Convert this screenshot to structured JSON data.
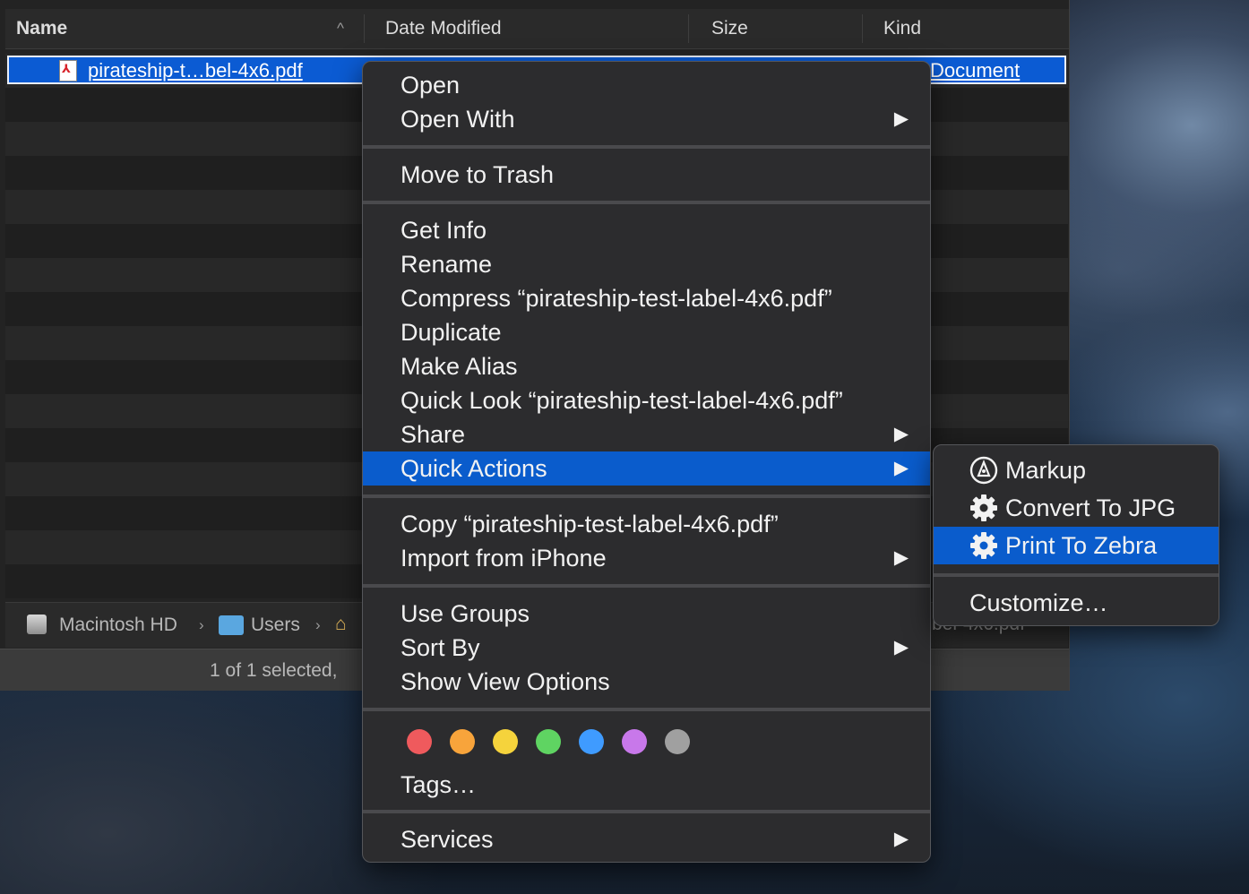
{
  "finder": {
    "columns": {
      "name": "Name",
      "date_modified": "Date Modified",
      "size": "Size",
      "kind": "Kind"
    },
    "sort_indicator": "^",
    "selected_file": {
      "name": "pirateship-t…bel-4x6.pdf",
      "kind_visible": "Document"
    },
    "pathbar": {
      "items": [
        "Macintosh HD",
        "Users"
      ],
      "separator": "›",
      "right_fragment": "bel-4x6.pdf"
    },
    "status": "1 of 1 selected,"
  },
  "context_menu": {
    "groups": [
      [
        {
          "label": "Open"
        },
        {
          "label": "Open With",
          "submenu": true
        }
      ],
      [
        {
          "label": "Move to Trash"
        }
      ],
      [
        {
          "label": "Get Info"
        },
        {
          "label": "Rename"
        },
        {
          "label": "Compress “pirateship-test-label-4x6.pdf”"
        },
        {
          "label": "Duplicate"
        },
        {
          "label": "Make Alias"
        },
        {
          "label": "Quick Look “pirateship-test-label-4x6.pdf”"
        },
        {
          "label": "Share",
          "submenu": true
        },
        {
          "label": "Quick Actions",
          "submenu": true,
          "highlighted": true
        }
      ],
      [
        {
          "label": "Copy “pirateship-test-label-4x6.pdf”"
        },
        {
          "label": "Import from iPhone",
          "submenu": true
        }
      ],
      [
        {
          "label": "Use Groups"
        },
        {
          "label": "Sort By",
          "submenu": true
        },
        {
          "label": "Show View Options"
        }
      ],
      [
        {
          "label": "Tags…"
        }
      ],
      [
        {
          "label": "Services",
          "submenu": true
        }
      ]
    ],
    "tag_colors": [
      "#ef5a5d",
      "#f8a43b",
      "#f5d33c",
      "#5fd462",
      "#3f9bff",
      "#c878ea",
      "#a0a0a0"
    ],
    "submenu_arrow": "▶"
  },
  "quick_actions_submenu": {
    "items": [
      {
        "label": "Markup",
        "icon": "markup-icon"
      },
      {
        "label": "Convert To JPG",
        "icon": "gear-icon"
      },
      {
        "label": "Print To Zebra",
        "icon": "gear-icon",
        "highlighted": true
      }
    ],
    "customize": "Customize…"
  },
  "colors": {
    "highlight": "#0a5ccc",
    "selection": "#0b5bd3",
    "menu_bg": "#2c2c2e"
  }
}
